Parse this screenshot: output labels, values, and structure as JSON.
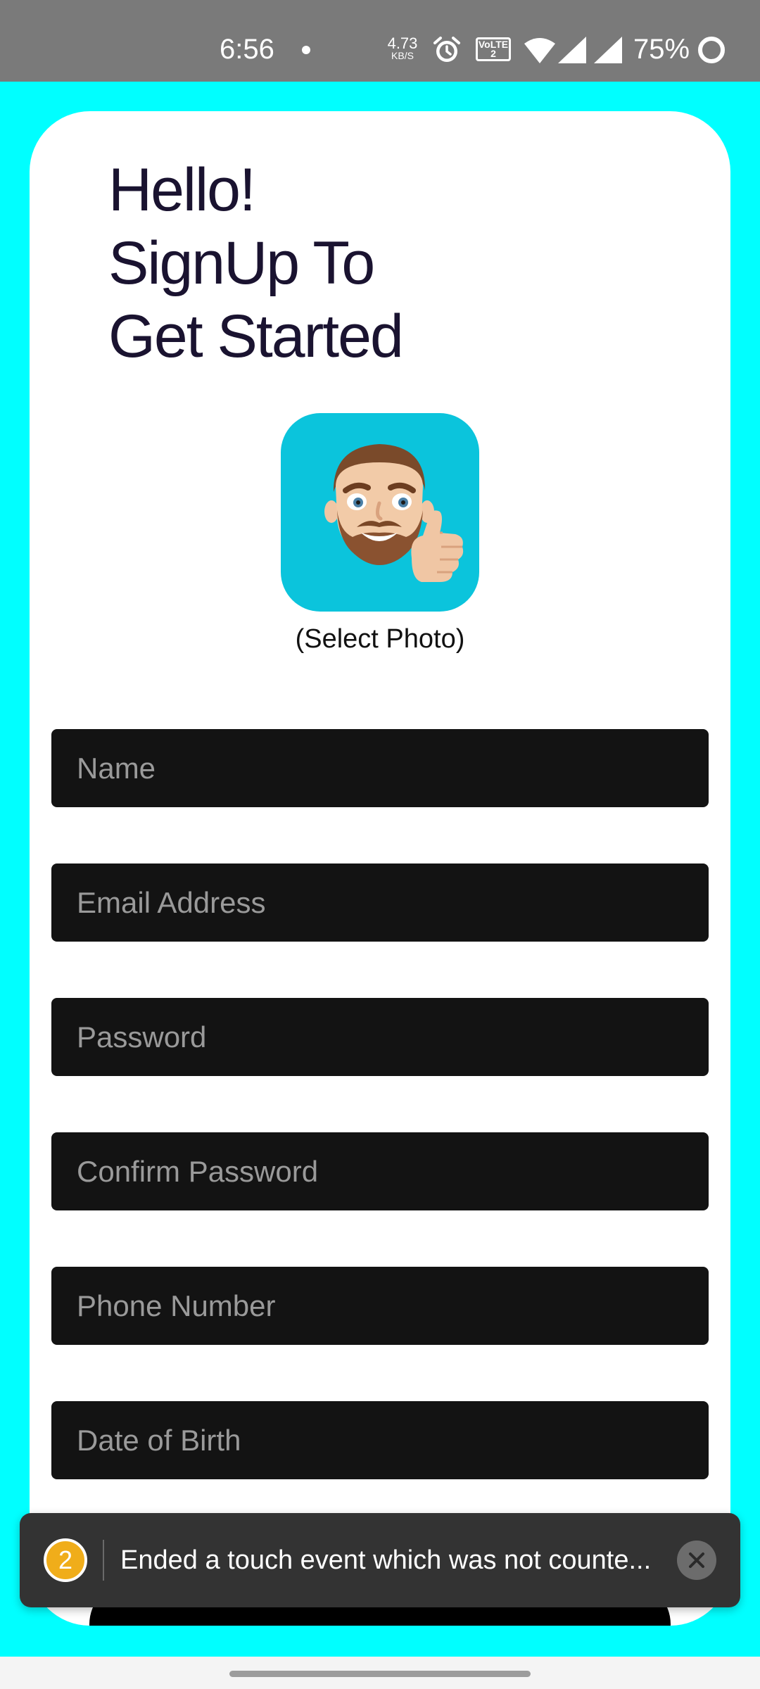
{
  "status_bar": {
    "time": "6:56",
    "network_speed_value": "4.73",
    "network_speed_unit": "KB/S",
    "volte_label": "VoLTE 2",
    "battery_percent": "75%",
    "icons": [
      "notification-dot",
      "alarm-icon",
      "volte-icon",
      "wifi-icon",
      "signal-icon",
      "signal-icon",
      "battery-ring-icon"
    ]
  },
  "signup": {
    "heading_lines": [
      "Hello!",
      "SignUp To",
      "Get Started"
    ],
    "select_photo_label": "(Select Photo)",
    "photo_icon": "avatar-memoji-thumbs-up",
    "fields": {
      "name": {
        "placeholder": "Name",
        "value": ""
      },
      "email": {
        "placeholder": "Email Address",
        "value": ""
      },
      "password": {
        "placeholder": "Password",
        "value": ""
      },
      "confirm_password": {
        "placeholder": "Confirm Password",
        "value": ""
      },
      "phone": {
        "placeholder": "Phone Number",
        "value": ""
      },
      "dob": {
        "placeholder": "Date of Birth",
        "value": ""
      }
    }
  },
  "toast": {
    "badge_count": "2",
    "message": "Ended a touch event which was not counte...",
    "close_icon": "close-icon"
  },
  "colors": {
    "background": "#00ffff",
    "card": "#ffffff",
    "heading_text": "#1a1330",
    "field_background": "#131313",
    "field_placeholder": "#9a9a9a",
    "photo_tile": "#0bc4dc",
    "status_bar": "#7a7a7a",
    "toast_background": "#333333",
    "toast_badge": "#f0ad1a"
  }
}
